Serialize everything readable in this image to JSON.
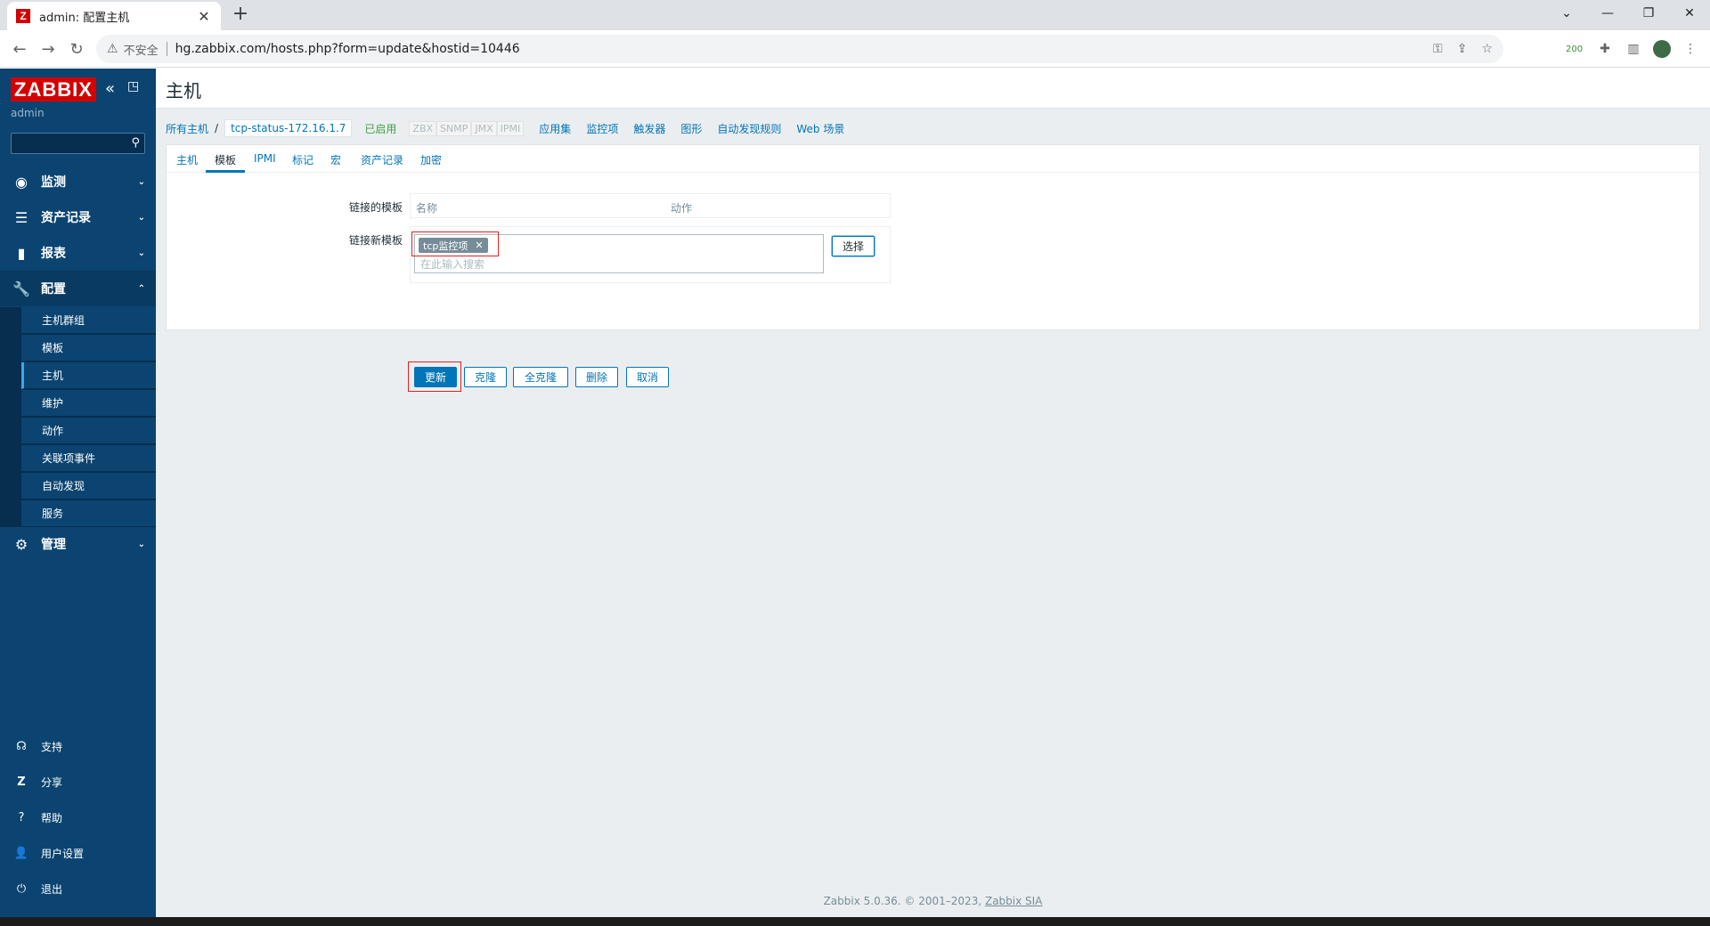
{
  "browser": {
    "tab_title": "admin: 配置主机",
    "favicon_letter": "Z",
    "insecure_label": "不安全",
    "url": "hg.zabbix.com/hosts.php?form=update&hostid=10446",
    "extension_badge": "200"
  },
  "sidebar": {
    "logo": "ZABBIX",
    "user": "admin",
    "search_placeholder": "",
    "menu": [
      {
        "label": "监测",
        "icon": "eye-icon"
      },
      {
        "label": "资产记录",
        "icon": "list-icon"
      },
      {
        "label": "报表",
        "icon": "bar-chart-icon"
      },
      {
        "label": "配置",
        "icon": "wrench-icon"
      },
      {
        "label": "管理",
        "icon": "gear-icon"
      }
    ],
    "config_submenu": [
      "主机群组",
      "模板",
      "主机",
      "维护",
      "动作",
      "关联项事件",
      "自动发现",
      "服务"
    ],
    "selected_submenu": "主机",
    "bottom": [
      {
        "label": "支持",
        "icon": "headset-icon"
      },
      {
        "label": "分享",
        "icon": "zabbix-share-icon"
      },
      {
        "label": "帮助",
        "icon": "question-icon"
      },
      {
        "label": "用户设置",
        "icon": "user-icon"
      },
      {
        "label": "退出",
        "icon": "power-icon"
      }
    ]
  },
  "page": {
    "title": "主机",
    "breadcrumb": {
      "root": "所有主机",
      "current": "tcp-status-172.16.1.7",
      "status": "已启用",
      "availability": [
        "ZBX",
        "SNMP",
        "JMX",
        "IPMI"
      ],
      "links": [
        "应用集",
        "监控项",
        "触发器",
        "图形",
        "自动发现规则",
        "Web 场景"
      ]
    },
    "tabs": [
      "主机",
      "模板",
      "IPMI",
      "标记",
      "宏",
      "资产记录",
      "加密"
    ],
    "active_tab": "模板",
    "form": {
      "linked_templates_label": "链接的模板",
      "linked_table_headers": [
        "名称",
        "动作"
      ],
      "link_new_label": "链接新模板",
      "selected_tag": "tcp监控项",
      "search_placeholder": "在此输入搜索",
      "select_button": "选择"
    },
    "buttons": [
      "更新",
      "克隆",
      "全克隆",
      "删除",
      "取消"
    ]
  },
  "footer": {
    "text": "Zabbix 5.0.36. © 2001–2023, ",
    "link": "Zabbix SIA"
  },
  "colors": {
    "sidebar": "#0b4471",
    "accent": "#0275b8",
    "logo": "#d40000",
    "highlight": "#e02020"
  }
}
